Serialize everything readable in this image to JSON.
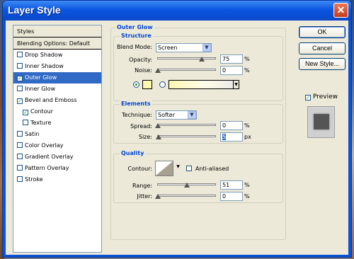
{
  "window": {
    "title": "Layer Style",
    "close_icon": "✕"
  },
  "styles_panel": {
    "header": "Styles",
    "blending": "Blending Options: Default",
    "items": [
      {
        "label": "Drop Shadow",
        "checked": false
      },
      {
        "label": "Inner Shadow",
        "checked": false
      },
      {
        "label": "Outer Glow",
        "checked": true,
        "selected": true
      },
      {
        "label": "Inner Glow",
        "checked": false
      },
      {
        "label": "Bevel and Emboss",
        "checked": true
      },
      {
        "label": "Contour",
        "checked": true,
        "indent": true
      },
      {
        "label": "Texture",
        "checked": false,
        "indent": true
      },
      {
        "label": "Satin",
        "checked": false
      },
      {
        "label": "Color Overlay",
        "checked": false
      },
      {
        "label": "Gradient Overlay",
        "checked": false
      },
      {
        "label": "Pattern Overlay",
        "checked": false
      },
      {
        "label": "Stroke",
        "checked": false
      }
    ]
  },
  "outer_glow": {
    "title": "Outer Glow",
    "structure": {
      "title": "Structure",
      "blend_mode_label": "Blend Mode:",
      "blend_mode_value": "Screen",
      "opacity_label": "Opacity:",
      "opacity_value": "75",
      "opacity_unit": "%",
      "noise_label": "Noise:",
      "noise_value": "0",
      "noise_unit": "%"
    },
    "elements": {
      "title": "Elements",
      "technique_label": "Technique:",
      "technique_value": "Softer",
      "spread_label": "Spread:",
      "spread_value": "0",
      "spread_unit": "%",
      "size_label": "Size:",
      "size_value": "5",
      "size_unit": "px"
    },
    "quality": {
      "title": "Quality",
      "contour_label": "Contour:",
      "anti_aliased_label": "Anti-aliased",
      "range_label": "Range:",
      "range_value": "51",
      "range_unit": "%",
      "jitter_label": "Jitter:",
      "jitter_value": "0",
      "jitter_unit": "%"
    }
  },
  "buttons": {
    "ok": "OK",
    "cancel": "Cancel",
    "new_style": "New Style..."
  },
  "preview": {
    "label": "Preview"
  },
  "colors": {
    "selection": "#316ac5",
    "titlebar": "#0b55e0",
    "glow_color": "#fff8b0"
  }
}
